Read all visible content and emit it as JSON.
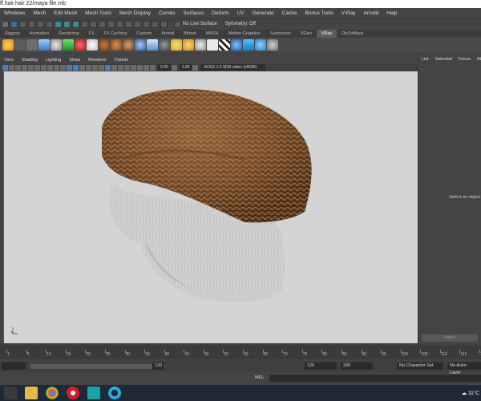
{
  "window": {
    "title": "ff.hair.hair 22/maya file.mb"
  },
  "menu": [
    "Windows",
    "Mesh",
    "Edit Mesh",
    "Mesh Tools",
    "Mesh Display",
    "Curves",
    "Surfaces",
    "Deform",
    "UV",
    "Generate",
    "Cache",
    "Bonus Tools",
    "V-Ray",
    "Arnold",
    "Help"
  ],
  "status_line": {
    "live_surface": "No Live Surface",
    "symmetry": "Symmetry: Off"
  },
  "shelf_tabs": [
    "Rigging",
    "Animation",
    "Rendering",
    "FX",
    "FX Caching",
    "Custom",
    "Arnold",
    "Bifrost",
    "MASH",
    "Motion Graphics",
    "Substance",
    "XGen",
    "VRay",
    "DisToMaya"
  ],
  "active_shelf_tab": "VRay",
  "viewport_menu": [
    "View",
    "Shading",
    "Lighting",
    "Show",
    "Renderer",
    "Panels"
  ],
  "viewport_toolbar": {
    "exposure": "0.00",
    "gamma": "1.00",
    "color_space": "ACES 1.0 SDR-video (sRGB)"
  },
  "right_panel": {
    "tabs": [
      "List",
      "Selected",
      "Focus",
      "Attrib"
    ],
    "message": "Select an object",
    "select_button": "Select"
  },
  "timeline": {
    "ticks": [
      "1",
      "5",
      "10",
      "15",
      "20",
      "25",
      "30",
      "35",
      "40",
      "45",
      "50",
      "55",
      "60",
      "65",
      "70",
      "75",
      "80",
      "85",
      "90",
      "95",
      "100",
      "105",
      "110",
      "115",
      "120"
    ]
  },
  "range": {
    "range_end": "120",
    "end": "120",
    "max": "200",
    "character_set": "No Character Set",
    "anim_layer": "No Anim Layer"
  },
  "command_line": {
    "label": "MEL"
  },
  "taskbar": {
    "weather": "11°C"
  }
}
